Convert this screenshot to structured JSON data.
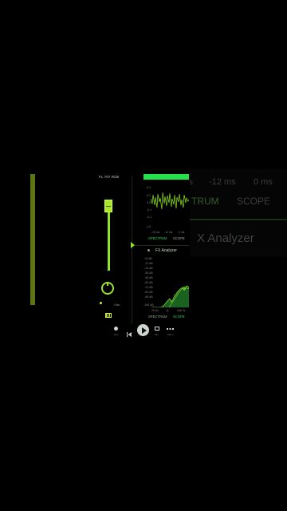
{
  "background_ghost": {
    "ms_a": "s",
    "ms_b": "-12 ms",
    "ms_c": "0 ms",
    "tab_spectrum": "TRUM",
    "tab_scope": "SCOPE",
    "title": "X Analyzer"
  },
  "mixer": {
    "track_name": "FL 707 Ride",
    "knob_label": "Gain",
    "fader_level": 0.92,
    "piano_icon": "piano-keys-icon"
  },
  "oscilloscope": {
    "y_labels": [
      "0.1",
      "0.1",
      "0.0",
      "-0.1",
      "-0.1",
      "-1.0"
    ],
    "time_labels": [
      "-25 ms",
      "-12 ms",
      "0 ms"
    ],
    "tabs": [
      "SPECTRUM",
      "SCOPE"
    ],
    "active_tab": "SPECTRUM"
  },
  "fx_analyzer": {
    "title": "FX Analyzer",
    "y_labels": [
      "+0 dB",
      "-12 dB",
      "-24 dB",
      "-36 dB",
      "-48 dB",
      "-60 dB",
      "-72 dB",
      "-84 dB",
      "-96 dB",
      "-108 dB"
    ],
    "freq_labels": [
      "25 Hz",
      "1k",
      "16k Hz"
    ],
    "tabs": [
      "SPECTRUM",
      "SCOPE"
    ],
    "active_tab": "SCOPE"
  },
  "transport": {
    "record_label": "Rec",
    "prev_label": "Prev",
    "play_label": "Play",
    "mixer_label": "Mix",
    "more_label": "Menu"
  },
  "colors": {
    "accent": "#8ee61e",
    "green_bright": "#24e04a",
    "tab_active": "#2bd34a"
  }
}
